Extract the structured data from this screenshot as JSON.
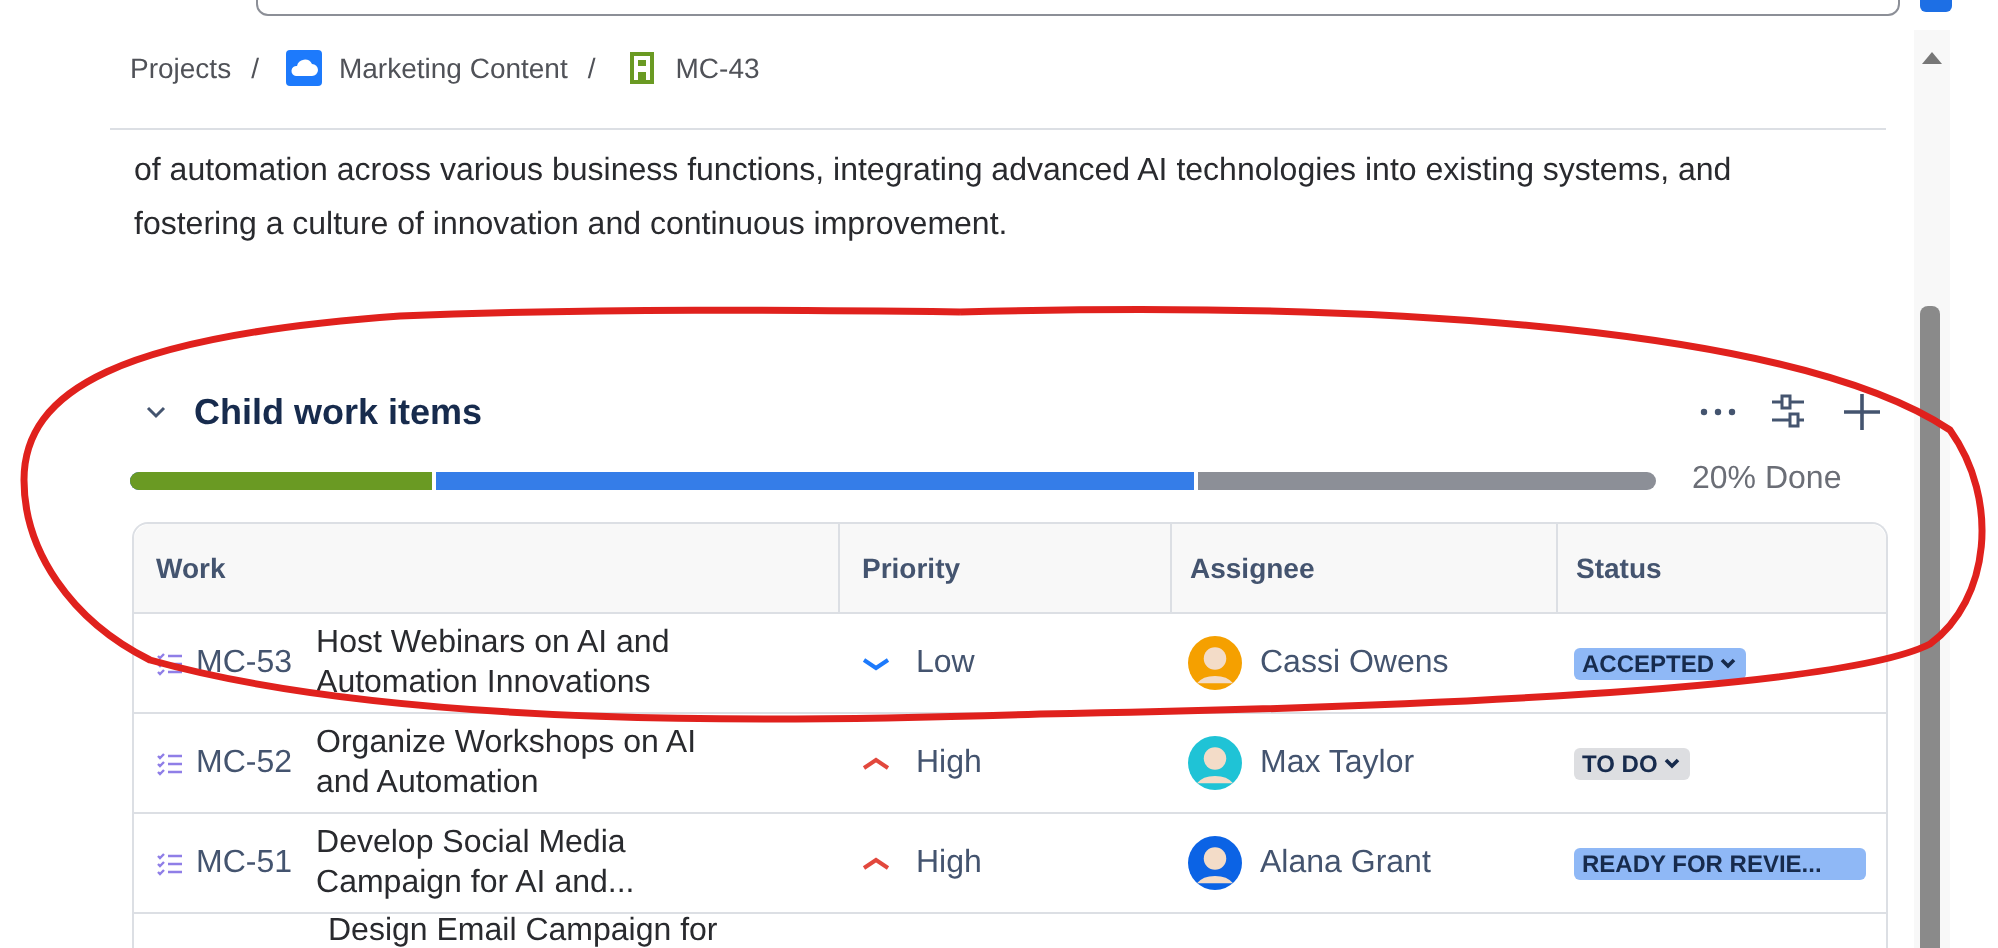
{
  "breadcrumbs": [
    {
      "label": "Projects"
    },
    {
      "separator": "/",
      "label": "Marketing Content"
    },
    {
      "separator": "/",
      "label": "MC-43"
    }
  ],
  "description": [
    "of automation across various business functions, integrating advanced AI technologies into existing systems, and",
    "fostering a culture of innovation and continuous improvement."
  ],
  "section": {
    "title": "Child work items",
    "expanded": true,
    "progress": {
      "segments": [
        {
          "color": "#6a9a23",
          "level": 0.2
        },
        {
          "color": "#357de8",
          "level": 0.7
        }
      ],
      "label": "20% Done"
    },
    "table": {
      "columns": [
        "Work",
        "Priority",
        "Assignee",
        "Status"
      ],
      "rows": [
        {
          "key": "MC-53",
          "title": "Host Webinars on AI and Automation Innovations",
          "priority": {
            "kind": "low",
            "label": "Low"
          },
          "assignee": {
            "name": "Cassi Owens",
            "color": "#f5a000"
          },
          "status": {
            "kind": "blue",
            "label": "ACCEPTED",
            "dropdown": true
          }
        },
        {
          "key": "MC-52",
          "title": "Organize Workshops on AI and Automation",
          "priority": {
            "kind": "high",
            "label": "High"
          },
          "assignee": {
            "name": "Max Taylor",
            "color": "#1fc3d6"
          },
          "status": {
            "kind": "grey",
            "label": "TO DO",
            "dropdown": true
          }
        },
        {
          "key": "MC-51",
          "title": "Develop Social Media Campaign for AI and...",
          "priority": {
            "kind": "high",
            "label": "High"
          },
          "assignee": {
            "name": "Alana Grant",
            "color": "#0b63e5"
          },
          "status": {
            "kind": "wide",
            "label": "READY FOR REVIE...",
            "dropdown": false
          }
        },
        {
          "title": "Design Email Campaign for"
        }
      ]
    }
  }
}
